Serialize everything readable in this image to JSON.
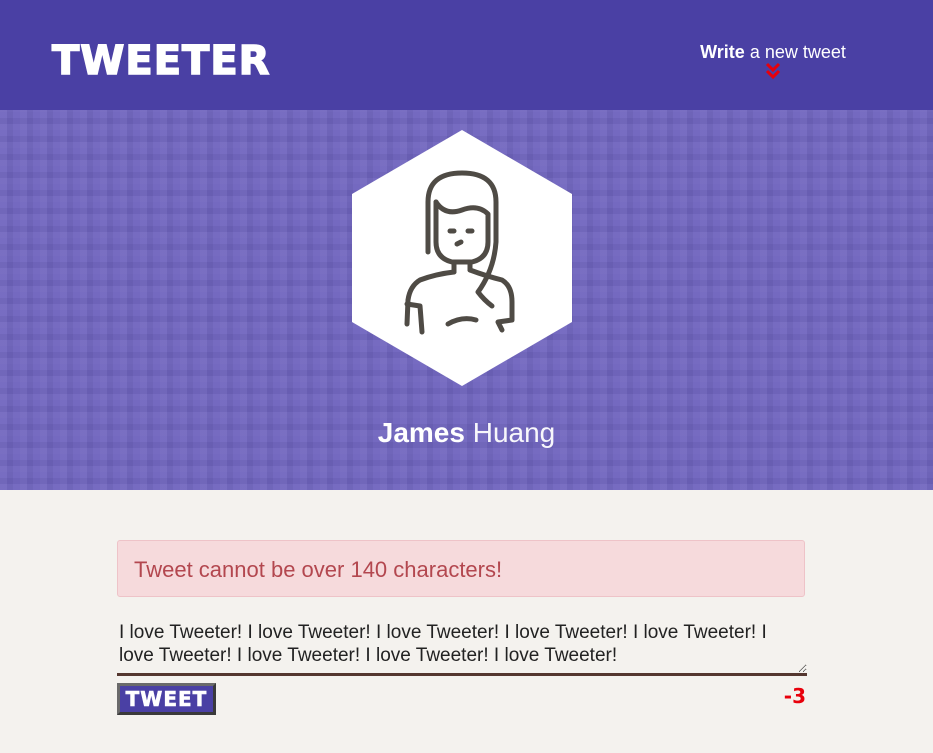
{
  "nav": {
    "logo": "TWEETER",
    "compose_bold": "Write",
    "compose_rest": " a new tweet",
    "compose_icon": "double-chevron-down-icon",
    "chevron_color": "#e8000b"
  },
  "profile": {
    "avatar_icon": "woman-avatar-icon",
    "first_name": "James",
    "last_name": "Huang"
  },
  "composer": {
    "error_message": "Tweet cannot be over 140 characters!",
    "textarea_value": "I love Tweeter! I love Tweeter! I love Tweeter! I love Tweeter! I love Tweeter! I love Tweeter! I love Tweeter! I love Tweeter! I love Tweeter!",
    "button_label": "TWEET",
    "counter": "-3"
  },
  "colors": {
    "brand": "#4a40a4",
    "profile_bg": "#6f64be",
    "page_bg": "#f4f2ee",
    "error_bg": "#f6dadc",
    "error_text": "#b3474f",
    "counter": "#e8000b"
  }
}
